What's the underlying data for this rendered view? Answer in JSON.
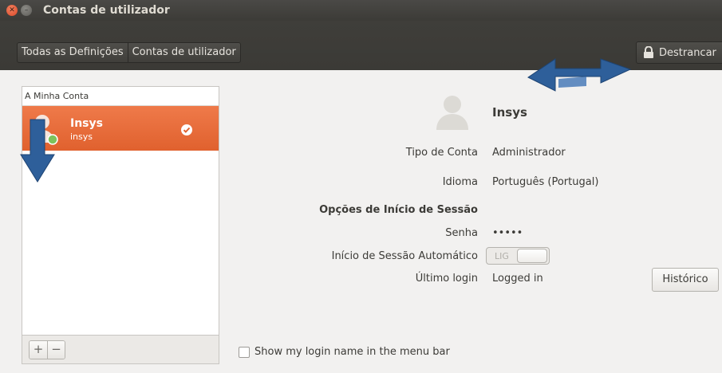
{
  "window": {
    "title": "Contas de utilizador"
  },
  "toolbar": {
    "breadcrumbs": [
      "Todas as Definições",
      "Contas de utilizador"
    ],
    "unlock_label": "Destrancar"
  },
  "sidebar": {
    "section_title": "A Minha Conta",
    "users": [
      {
        "name": "Insys",
        "login": "insys",
        "status": "online"
      }
    ],
    "add_label": "+",
    "remove_label": "−"
  },
  "detail": {
    "user_name": "Insys",
    "account_type_label": "Tipo de Conta",
    "account_type_value": "Administrador",
    "language_label": "Idioma",
    "language_value": "Português (Portugal)",
    "login_options_heading": "Opções de Início de Sessão",
    "password_label": "Senha",
    "password_value": "•••••",
    "auto_login_label": "Início de Sessão Automático",
    "auto_login_toggle": "LIG",
    "last_login_label": "Último login",
    "last_login_value": "Logged in",
    "history_button": "Histórico",
    "show_login_name_label": "Show my login name in the menu bar"
  },
  "colors": {
    "accent": "#e6642f",
    "titlebar": "#3c3b37",
    "annotation_arrow": "#2e5f9a"
  }
}
